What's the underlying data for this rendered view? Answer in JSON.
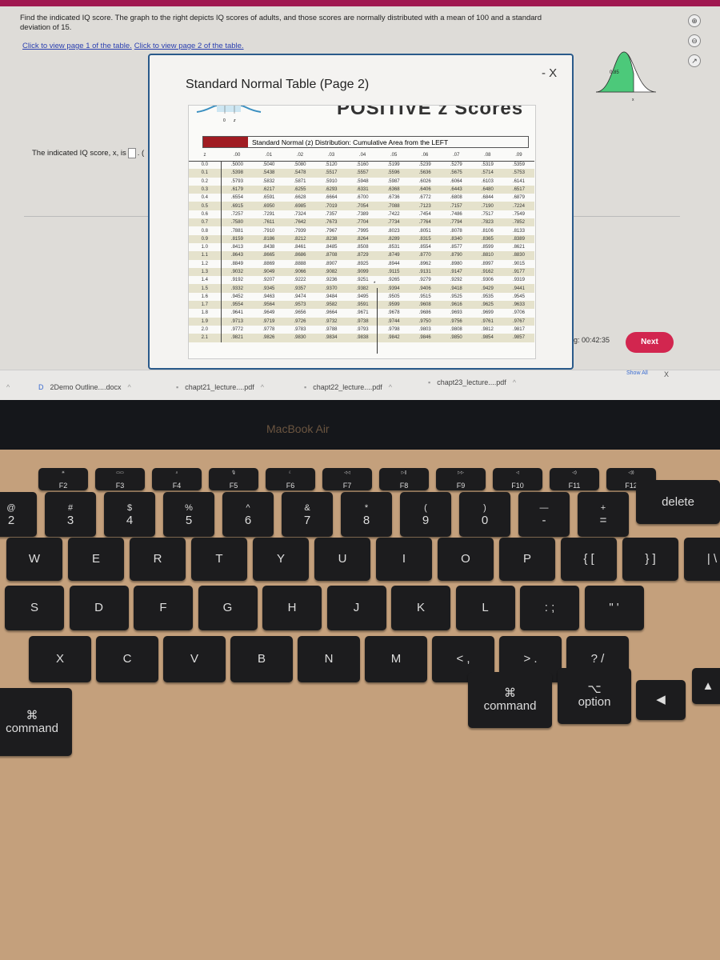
{
  "question": {
    "text": "Find the indicated IQ score. The graph to the right depicts IQ scores of adults, and those scores are normally distributed with a mean of 100 and a standard deviation of 15.",
    "link1": "Click to view page 1 of the table.",
    "link2": "Click to view page 2 of the table.",
    "answer_prefix": "The indicated IQ score, x, is",
    "answer_value": "",
    "answer_suffix": ". ("
  },
  "graph": {
    "area_label": "0.85",
    "x_label": "x",
    "fill_color": "#4cc97a"
  },
  "popup": {
    "title": "Standard Normal Table (Page 2)",
    "minimize": "-",
    "close": "X",
    "heading": "POSITIVE z Scores",
    "curve_labels": [
      "0",
      "z"
    ],
    "caption": "Standard Normal (z) Distribution: Cumulative Area from the LEFT",
    "annotation_mark": "*",
    "columns": [
      "z",
      ".00",
      ".01",
      ".02",
      ".03",
      ".04",
      ".05",
      ".06",
      ".07",
      ".08",
      ".09"
    ],
    "rows": [
      [
        "0.0",
        ".5000",
        ".5040",
        ".5080",
        ".5120",
        ".5160",
        ".5199",
        ".5239",
        ".5279",
        ".5319",
        ".5359"
      ],
      [
        "0.1",
        ".5398",
        ".5438",
        ".5478",
        ".5517",
        ".5557",
        ".5596",
        ".5636",
        ".5675",
        ".5714",
        ".5753"
      ],
      [
        "0.2",
        ".5793",
        ".5832",
        ".5871",
        ".5910",
        ".5948",
        ".5987",
        ".6026",
        ".6064",
        ".6103",
        ".6141"
      ],
      [
        "0.3",
        ".6179",
        ".6217",
        ".6255",
        ".6293",
        ".6331",
        ".6368",
        ".6406",
        ".6443",
        ".6480",
        ".6517"
      ],
      [
        "0.4",
        ".6554",
        ".6591",
        ".6628",
        ".6664",
        ".6700",
        ".6736",
        ".6772",
        ".6808",
        ".6844",
        ".6879"
      ],
      [
        "0.5",
        ".6915",
        ".6950",
        ".6985",
        ".7019",
        ".7054",
        ".7088",
        ".7123",
        ".7157",
        ".7190",
        ".7224"
      ],
      [
        "0.6",
        ".7257",
        ".7291",
        ".7324",
        ".7357",
        ".7389",
        ".7422",
        ".7454",
        ".7486",
        ".7517",
        ".7549"
      ],
      [
        "0.7",
        ".7580",
        ".7611",
        ".7642",
        ".7673",
        ".7704",
        ".7734",
        ".7764",
        ".7794",
        ".7823",
        ".7852"
      ],
      [
        "0.8",
        ".7881",
        ".7910",
        ".7939",
        ".7967",
        ".7995",
        ".8023",
        ".8051",
        ".8078",
        ".8106",
        ".8133"
      ],
      [
        "0.9",
        ".8159",
        ".8186",
        ".8212",
        ".8238",
        ".8264",
        ".8289",
        ".8315",
        ".8340",
        ".8365",
        ".8389"
      ],
      [
        "1.0",
        ".8413",
        ".8438",
        ".8461",
        ".8485",
        ".8508",
        ".8531",
        ".8554",
        ".8577",
        ".8599",
        ".8621"
      ],
      [
        "1.1",
        ".8643",
        ".8665",
        ".8686",
        ".8708",
        ".8729",
        ".8749",
        ".8770",
        ".8790",
        ".8810",
        ".8830"
      ],
      [
        "1.2",
        ".8849",
        ".8869",
        ".8888",
        ".8907",
        ".8925",
        ".8944",
        ".8962",
        ".8980",
        ".8997",
        ".9015"
      ],
      [
        "1.3",
        ".9032",
        ".9049",
        ".9066",
        ".9082",
        ".9099",
        ".9115",
        ".9131",
        ".9147",
        ".9162",
        ".9177"
      ],
      [
        "1.4",
        ".9192",
        ".9207",
        ".9222",
        ".9236",
        ".9251",
        ".9265",
        ".9279",
        ".9292",
        ".9306",
        ".9319"
      ],
      [
        "1.5",
        ".9332",
        ".9345",
        ".9357",
        ".9370",
        ".9382",
        ".9394",
        ".9406",
        ".9418",
        ".9429",
        ".9441"
      ],
      [
        "1.6",
        ".9452",
        ".9463",
        ".9474",
        ".9484",
        ".9495",
        ".9505",
        ".9515",
        ".9525",
        ".9535",
        ".9545"
      ],
      [
        "1.7",
        ".9554",
        ".9564",
        ".9573",
        ".9582",
        ".9591",
        ".9599",
        ".9608",
        ".9616",
        ".9625",
        ".9633"
      ],
      [
        "1.8",
        ".9641",
        ".9649",
        ".9656",
        ".9664",
        ".9671",
        ".9678",
        ".9686",
        ".9693",
        ".9699",
        ".9706"
      ],
      [
        "1.9",
        ".9713",
        ".9719",
        ".9726",
        ".9732",
        ".9738",
        ".9744",
        ".9750",
        ".9756",
        ".9761",
        ".9767"
      ],
      [
        "2.0",
        ".9772",
        ".9778",
        ".9783",
        ".9788",
        ".9793",
        ".9798",
        ".9803",
        ".9808",
        ".9812",
        ".9817"
      ],
      [
        "2.1",
        ".9821",
        ".9826",
        ".9830",
        ".9834",
        ".9838",
        ".9842",
        ".9846",
        ".9850",
        ".9854",
        ".9857"
      ]
    ]
  },
  "side_icons": [
    "zoom-in-icon",
    "zoom-out-icon",
    "external-link-icon"
  ],
  "timer": "ning: 00:42:35",
  "next_label": "Next",
  "downloads": {
    "items": [
      "2Demo Outline....docx",
      "chapt21_lecture....pdf",
      "chapt22_lecture....pdf",
      "chapt23_lecture....pdf"
    ],
    "show_all": "Show All",
    "close": "X",
    "chevron": "^"
  },
  "device_label": "MacBook Air",
  "keyboard": {
    "fn_row": [
      [
        "☀",
        "F2"
      ],
      [
        "▭▭",
        "F3"
      ],
      [
        "⌕",
        "F4"
      ],
      [
        "🎙",
        "F5"
      ],
      [
        "☾",
        "F6"
      ],
      [
        "◁◁",
        "F7"
      ],
      [
        "▷||",
        "F8"
      ],
      [
        "▷▷",
        "F9"
      ],
      [
        "◁",
        "F10"
      ],
      [
        "◁)",
        "F11"
      ],
      [
        "◁))",
        "F12"
      ]
    ],
    "number_row": [
      [
        "@",
        "2"
      ],
      [
        "#",
        "3"
      ],
      [
        "$",
        "4"
      ],
      [
        "%",
        "5"
      ],
      [
        "^",
        "6"
      ],
      [
        "&",
        "7"
      ],
      [
        "*",
        "8"
      ],
      [
        "(",
        "9"
      ],
      [
        ")",
        "0"
      ],
      [
        "—",
        "-"
      ],
      [
        "+",
        "="
      ],
      [
        "",
        "delete"
      ]
    ],
    "top_row": [
      "W",
      "E",
      "R",
      "T",
      "Y",
      "U",
      "I",
      "O",
      "P",
      "{ [",
      "} ]",
      "| \\"
    ],
    "home_row": [
      "S",
      "D",
      "F",
      "G",
      "H",
      "J",
      "K",
      "L",
      ": ;",
      "\" '"
    ],
    "bottom_row": [
      "X",
      "C",
      "V",
      "B",
      "N",
      "M",
      "< ,",
      "> .",
      "? /"
    ],
    "left_command": "command",
    "left_command_symbol": "⌘",
    "right_command": "command",
    "right_command_symbol": "⌘",
    "option": "option",
    "option_symbol": "⌥",
    "arrow_left": "◀",
    "arrow_up": "▲"
  }
}
